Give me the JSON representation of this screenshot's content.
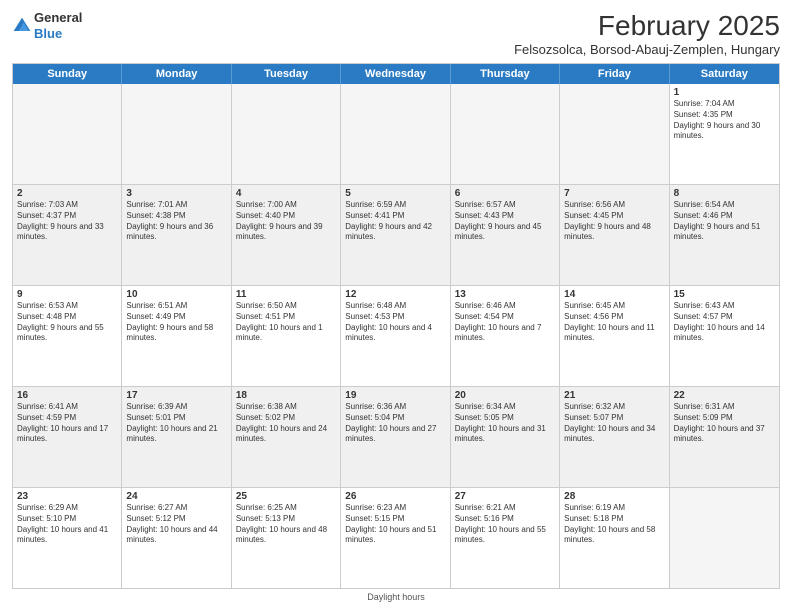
{
  "header": {
    "logo_general": "General",
    "logo_blue": "Blue",
    "month_title": "February 2025",
    "subtitle": "Felsozsolca, Borsod-Abauj-Zemplen, Hungary"
  },
  "calendar": {
    "days_of_week": [
      "Sunday",
      "Monday",
      "Tuesday",
      "Wednesday",
      "Thursday",
      "Friday",
      "Saturday"
    ],
    "weeks": [
      [
        {
          "day": "",
          "text": "",
          "empty": true
        },
        {
          "day": "",
          "text": "",
          "empty": true
        },
        {
          "day": "",
          "text": "",
          "empty": true
        },
        {
          "day": "",
          "text": "",
          "empty": true
        },
        {
          "day": "",
          "text": "",
          "empty": true
        },
        {
          "day": "",
          "text": "",
          "empty": true
        },
        {
          "day": "1",
          "text": "Sunrise: 7:04 AM\nSunset: 4:35 PM\nDaylight: 9 hours and 30 minutes."
        }
      ],
      [
        {
          "day": "2",
          "text": "Sunrise: 7:03 AM\nSunset: 4:37 PM\nDaylight: 9 hours and 33 minutes."
        },
        {
          "day": "3",
          "text": "Sunrise: 7:01 AM\nSunset: 4:38 PM\nDaylight: 9 hours and 36 minutes."
        },
        {
          "day": "4",
          "text": "Sunrise: 7:00 AM\nSunset: 4:40 PM\nDaylight: 9 hours and 39 minutes."
        },
        {
          "day": "5",
          "text": "Sunrise: 6:59 AM\nSunset: 4:41 PM\nDaylight: 9 hours and 42 minutes."
        },
        {
          "day": "6",
          "text": "Sunrise: 6:57 AM\nSunset: 4:43 PM\nDaylight: 9 hours and 45 minutes."
        },
        {
          "day": "7",
          "text": "Sunrise: 6:56 AM\nSunset: 4:45 PM\nDaylight: 9 hours and 48 minutes."
        },
        {
          "day": "8",
          "text": "Sunrise: 6:54 AM\nSunset: 4:46 PM\nDaylight: 9 hours and 51 minutes."
        }
      ],
      [
        {
          "day": "9",
          "text": "Sunrise: 6:53 AM\nSunset: 4:48 PM\nDaylight: 9 hours and 55 minutes."
        },
        {
          "day": "10",
          "text": "Sunrise: 6:51 AM\nSunset: 4:49 PM\nDaylight: 9 hours and 58 minutes."
        },
        {
          "day": "11",
          "text": "Sunrise: 6:50 AM\nSunset: 4:51 PM\nDaylight: 10 hours and 1 minute."
        },
        {
          "day": "12",
          "text": "Sunrise: 6:48 AM\nSunset: 4:53 PM\nDaylight: 10 hours and 4 minutes."
        },
        {
          "day": "13",
          "text": "Sunrise: 6:46 AM\nSunset: 4:54 PM\nDaylight: 10 hours and 7 minutes."
        },
        {
          "day": "14",
          "text": "Sunrise: 6:45 AM\nSunset: 4:56 PM\nDaylight: 10 hours and 11 minutes."
        },
        {
          "day": "15",
          "text": "Sunrise: 6:43 AM\nSunset: 4:57 PM\nDaylight: 10 hours and 14 minutes."
        }
      ],
      [
        {
          "day": "16",
          "text": "Sunrise: 6:41 AM\nSunset: 4:59 PM\nDaylight: 10 hours and 17 minutes."
        },
        {
          "day": "17",
          "text": "Sunrise: 6:39 AM\nSunset: 5:01 PM\nDaylight: 10 hours and 21 minutes."
        },
        {
          "day": "18",
          "text": "Sunrise: 6:38 AM\nSunset: 5:02 PM\nDaylight: 10 hours and 24 minutes."
        },
        {
          "day": "19",
          "text": "Sunrise: 6:36 AM\nSunset: 5:04 PM\nDaylight: 10 hours and 27 minutes."
        },
        {
          "day": "20",
          "text": "Sunrise: 6:34 AM\nSunset: 5:05 PM\nDaylight: 10 hours and 31 minutes."
        },
        {
          "day": "21",
          "text": "Sunrise: 6:32 AM\nSunset: 5:07 PM\nDaylight: 10 hours and 34 minutes."
        },
        {
          "day": "22",
          "text": "Sunrise: 6:31 AM\nSunset: 5:09 PM\nDaylight: 10 hours and 37 minutes."
        }
      ],
      [
        {
          "day": "23",
          "text": "Sunrise: 6:29 AM\nSunset: 5:10 PM\nDaylight: 10 hours and 41 minutes."
        },
        {
          "day": "24",
          "text": "Sunrise: 6:27 AM\nSunset: 5:12 PM\nDaylight: 10 hours and 44 minutes."
        },
        {
          "day": "25",
          "text": "Sunrise: 6:25 AM\nSunset: 5:13 PM\nDaylight: 10 hours and 48 minutes."
        },
        {
          "day": "26",
          "text": "Sunrise: 6:23 AM\nSunset: 5:15 PM\nDaylight: 10 hours and 51 minutes."
        },
        {
          "day": "27",
          "text": "Sunrise: 6:21 AM\nSunset: 5:16 PM\nDaylight: 10 hours and 55 minutes."
        },
        {
          "day": "28",
          "text": "Sunrise: 6:19 AM\nSunset: 5:18 PM\nDaylight: 10 hours and 58 minutes."
        },
        {
          "day": "",
          "text": "",
          "empty": true
        }
      ]
    ],
    "legend": "Daylight hours"
  }
}
